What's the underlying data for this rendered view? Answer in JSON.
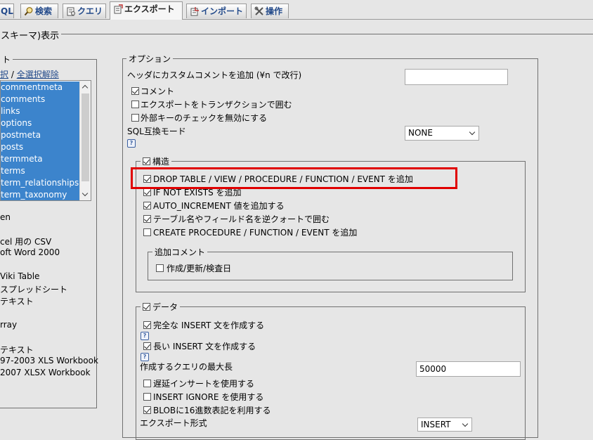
{
  "tabs": [
    {
      "label": "QL",
      "icon": "sql-icon"
    },
    {
      "label": "検索",
      "icon": "search-icon"
    },
    {
      "label": "クエリ",
      "icon": "query-icon"
    },
    {
      "label": "エクスポート",
      "icon": "export-icon",
      "active": true
    },
    {
      "label": "インポート",
      "icon": "import-icon"
    },
    {
      "label": "操作",
      "icon": "operations-icon"
    }
  ],
  "page_title": "スキーマ)表示",
  "left": {
    "legend": "ト",
    "select_links": {
      "select_all": "択",
      "separator": "/",
      "deselect_all": "全選択解除"
    },
    "tables": [
      "commentmeta",
      "comments",
      "links",
      "options",
      "postmeta",
      "posts",
      "termmeta",
      "terms",
      "term_relationships",
      "term_taxonomy"
    ],
    "formats": [
      "en",
      "cel 用の CSV",
      "oft Word 2000",
      "Viki Table",
      "スプレッドシート",
      "テキスト",
      "rray",
      "テキスト",
      "97-2003 XLS Workbook",
      "2007 XLSX Workbook"
    ]
  },
  "options": {
    "legend": "オプション",
    "header_comment_label": "ヘッダにカスタムコメントを追加 (¥n で改行)",
    "header_comment_value": "",
    "comment_label": "コメント",
    "transaction_label": "エクスポートをトランザクションで囲む",
    "disable_fk_label": "外部キーのチェックを無効にする",
    "sql_compat_label": "SQL互換モード",
    "sql_compat_value": "NONE",
    "help": "?"
  },
  "structure": {
    "legend": "構造",
    "drop_table": "DROP TABLE / VIEW / PROCEDURE / FUNCTION / EVENT を追加",
    "if_not_exists": "IF NOT EXISTS を追加",
    "auto_increment": "AUTO_INCREMENT 値を追加する",
    "backquote": "テーブル名やフィールド名を逆クォートで囲む",
    "create_procedure": "CREATE PROCEDURE / FUNCTION / EVENT を追加",
    "extra_comment_legend": "追加コメント",
    "dates_label": "作成/更新/検査日"
  },
  "data": {
    "legend": "データ",
    "complete_insert": "完全な INSERT 文を作成する",
    "extended_insert": "長い INSERT 文を作成する",
    "max_query_label": "作成するクエリの最大長",
    "max_query_value": "50000",
    "delayed_insert": "遅延インサートを使用する",
    "insert_ignore": "INSERT IGNORE を使用する",
    "blob_hex": "BLOBに16進数表記を利用する",
    "export_type_label": "エクスポート形式",
    "export_type_value": "INSERT"
  }
}
